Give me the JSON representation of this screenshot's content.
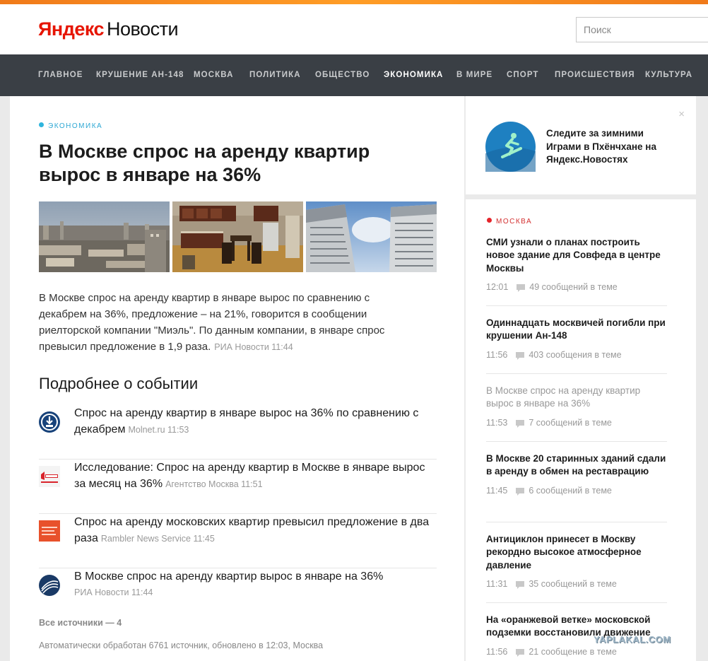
{
  "header": {
    "logo_brand": "Яндекс",
    "logo_service": "Новости",
    "search_placeholder": "Поиск"
  },
  "nav": {
    "items": [
      {
        "label": "ГЛАВНОЕ",
        "active": false
      },
      {
        "label": "КРУШЕНИЕ АН-148",
        "active": false
      },
      {
        "label": "МОСКВА",
        "active": false
      },
      {
        "label": "ПОЛИТИКА",
        "active": false
      },
      {
        "label": "ОБЩЕСТВО",
        "active": false
      },
      {
        "label": "ЭКОНОМИКА",
        "active": true
      },
      {
        "label": "В МИРЕ",
        "active": false
      },
      {
        "label": "СПОРТ",
        "active": false
      },
      {
        "label": "ПРОИСШЕСТВИЯ",
        "active": false
      },
      {
        "label": "КУЛЬТУРА",
        "active": false
      }
    ]
  },
  "article": {
    "rubric": "ЭКОНОМИКА",
    "title": "В Москве спрос на аренду квартир вырос в январе на 36%",
    "lead": "В Москве спрос на аренду квартир в январе вырос по сравнению с декабрем на 36%, предложение – на 21%, говорится в сообщении риелторской компании \"Миэль\". По данным компании, в январе спрос превысил предложение в 1,9 раза.",
    "lead_source": "РИА Новости 11:44"
  },
  "more": {
    "title": "Подробнее о событии",
    "stories": [
      {
        "text": "Спрос на аренду квартир в январе вырос на 36% по сравнению с декабрем",
        "meta": "Molnet.ru 11:53",
        "icon": "molnet-logo-icon"
      },
      {
        "text": "Исследование: Спрос на аренду квартир в Москве в январе вырос за месяц на 36%",
        "meta": "Агентство Москва 11:51",
        "icon": "moskva-agency-logo-icon"
      },
      {
        "text": "Спрос на аренду московских квартир превысил предложение в два раза",
        "meta": "Rambler News Service 11:45",
        "icon": "rambler-logo-icon"
      },
      {
        "text": "В Москве спрос на аренду квартир вырос в январе на 36%",
        "meta": "РИА Новости 11:44",
        "icon": "ria-logo-icon"
      }
    ],
    "all_sources": "Все источники — 4",
    "auto_note": "Автоматически обработан 6761 источник, обновлено в 12:03, Москва"
  },
  "promo": {
    "text": "Следите за зимними Играми в Пхёнчхане на Яндекс.Новостях",
    "close": "×"
  },
  "side": {
    "rubric": "МОСКВА",
    "items": [
      {
        "title": "СМИ узнали о планах построить новое здание для Совфеда в центре Москвы",
        "time": "12:01",
        "comments": "49 сообщений в теме",
        "read": false
      },
      {
        "title": "Одиннадцать москвичей погибли при крушении Ан-148",
        "time": "11:56",
        "comments": "403 сообщения в теме",
        "read": false
      },
      {
        "title": "В Москве спрос на аренду квартир вырос в январе на 36%",
        "time": "11:53",
        "comments": "7 сообщений в теме",
        "read": true
      },
      {
        "title": "В Москве 20 старинных зданий сдали в аренду в обмен на реставрацию",
        "time": "11:45",
        "comments": "6 сообщений в теме",
        "read": false
      },
      {
        "title": "Антициклон принесет в Москву рекордно высокое атмосферное давление",
        "time": "11:31",
        "comments": "35 сообщений в теме",
        "read": false
      },
      {
        "title": "На «оранжевой ветке» московской подземки восстановили движение",
        "time": "11:56",
        "comments": "21 сообщение в теме",
        "read": false
      }
    ]
  },
  "watermark": "YAPLAKAL.COM",
  "colors": {
    "accent": "#ffcc00",
    "nav_bg": "#3a3f45",
    "rubric_economy": "#2fb5dd",
    "rubric_moscow": "#e5242a"
  }
}
